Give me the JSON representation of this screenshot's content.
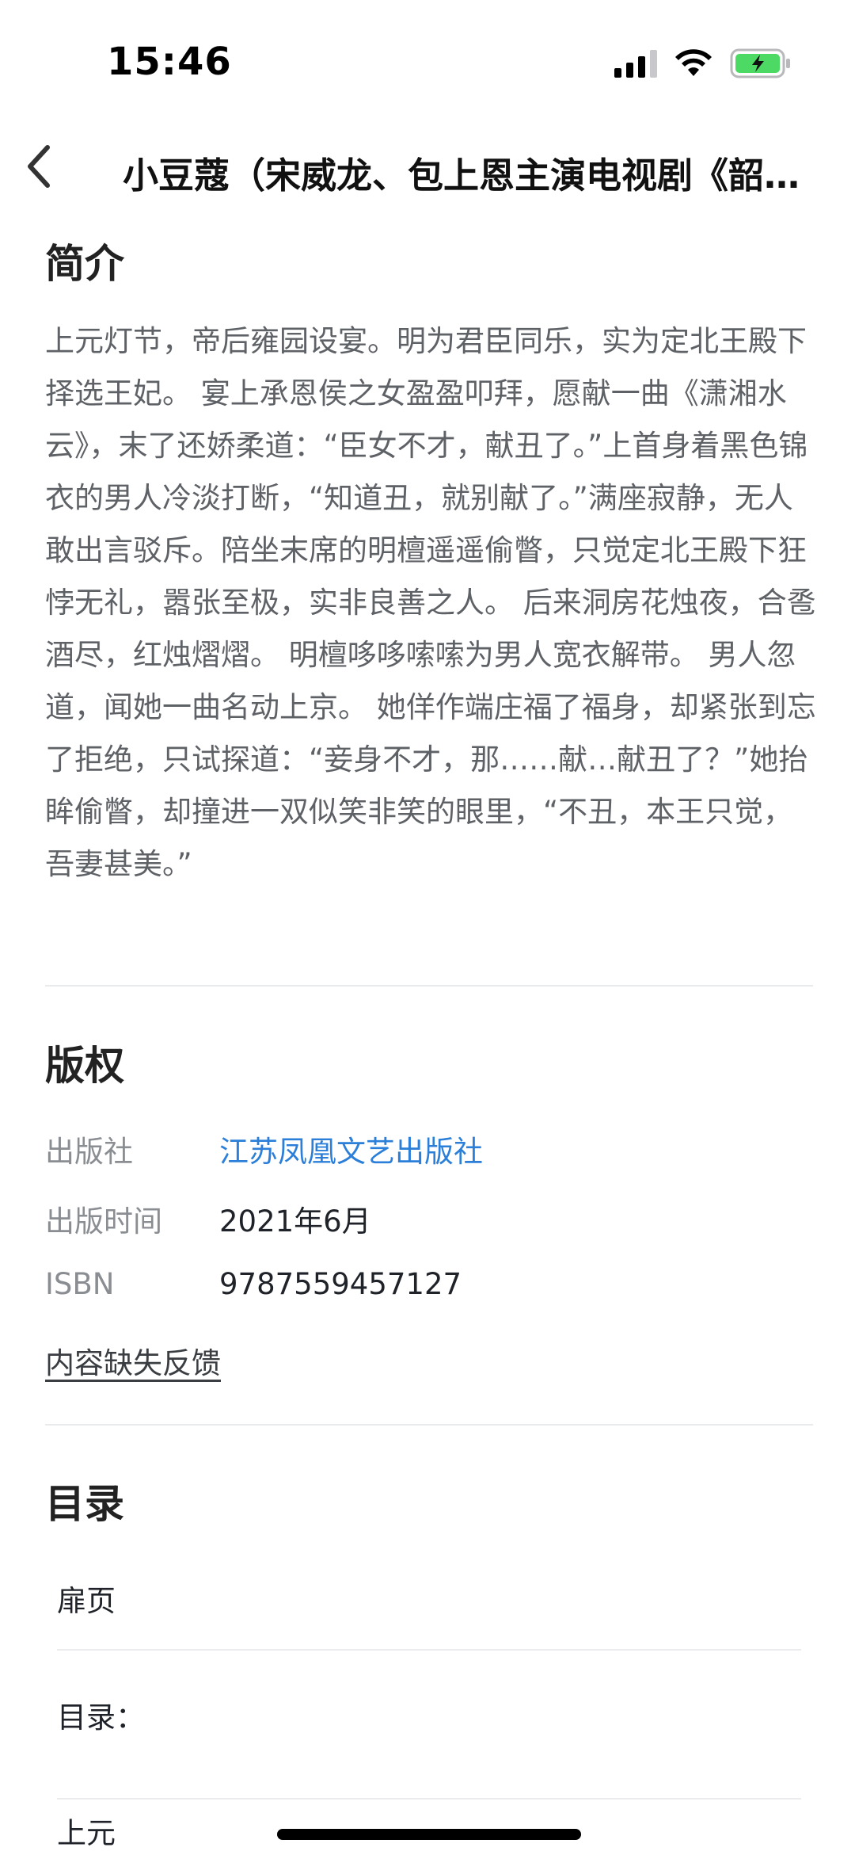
{
  "status_bar": {
    "time": "15:46",
    "battery": "charging"
  },
  "nav": {
    "title": "小豆蔻（宋威龙、包上恩主演电视剧《韶…",
    "back_icon": "chevron-left-icon"
  },
  "intro": {
    "heading": "简介",
    "text": "上元灯节，帝后雍园设宴。明为君臣同乐，实为定北王殿下择选王妃。 宴上承恩侯之女盈盈叩拜，愿献一曲《潇湘水云》，末了还娇柔道：“臣女不才，献丑了。”上首身着黑色锦衣的男人冷淡打断，“知道丑，就别献了。”满座寂静，无人敢出言驳斥。陪坐末席的明檀遥遥偷瞥，只觉定北王殿下狂悖无礼，嚣张至极，实非良善之人。 后来洞房花烛夜，合卺酒尽，红烛熠熠。 明檀哆哆嗦嗦为男人宽衣解带。 男人忽道，闻她一曲名动上京。 她佯作端庄福了福身，却紧张到忘了拒绝，只试探道：“妾身不才，那……献…献丑了？”她抬眸偷瞥，却撞进一双似笑非笑的眼里，“不丑，本王只觉，吾妻甚美。”"
  },
  "copyright": {
    "heading": "版权",
    "publisher_label": "出版社",
    "publisher_value": "江苏凤凰文艺出版社",
    "date_label": "出版时间",
    "date_value": "2021年6月",
    "isbn_label": "ISBN",
    "isbn_value": "9787559457127",
    "feedback": "内容缺失反馈",
    "link_color": "#2b7fd9"
  },
  "toc": {
    "heading": "目录",
    "items": [
      "扉页",
      "目录：",
      "上元"
    ]
  }
}
